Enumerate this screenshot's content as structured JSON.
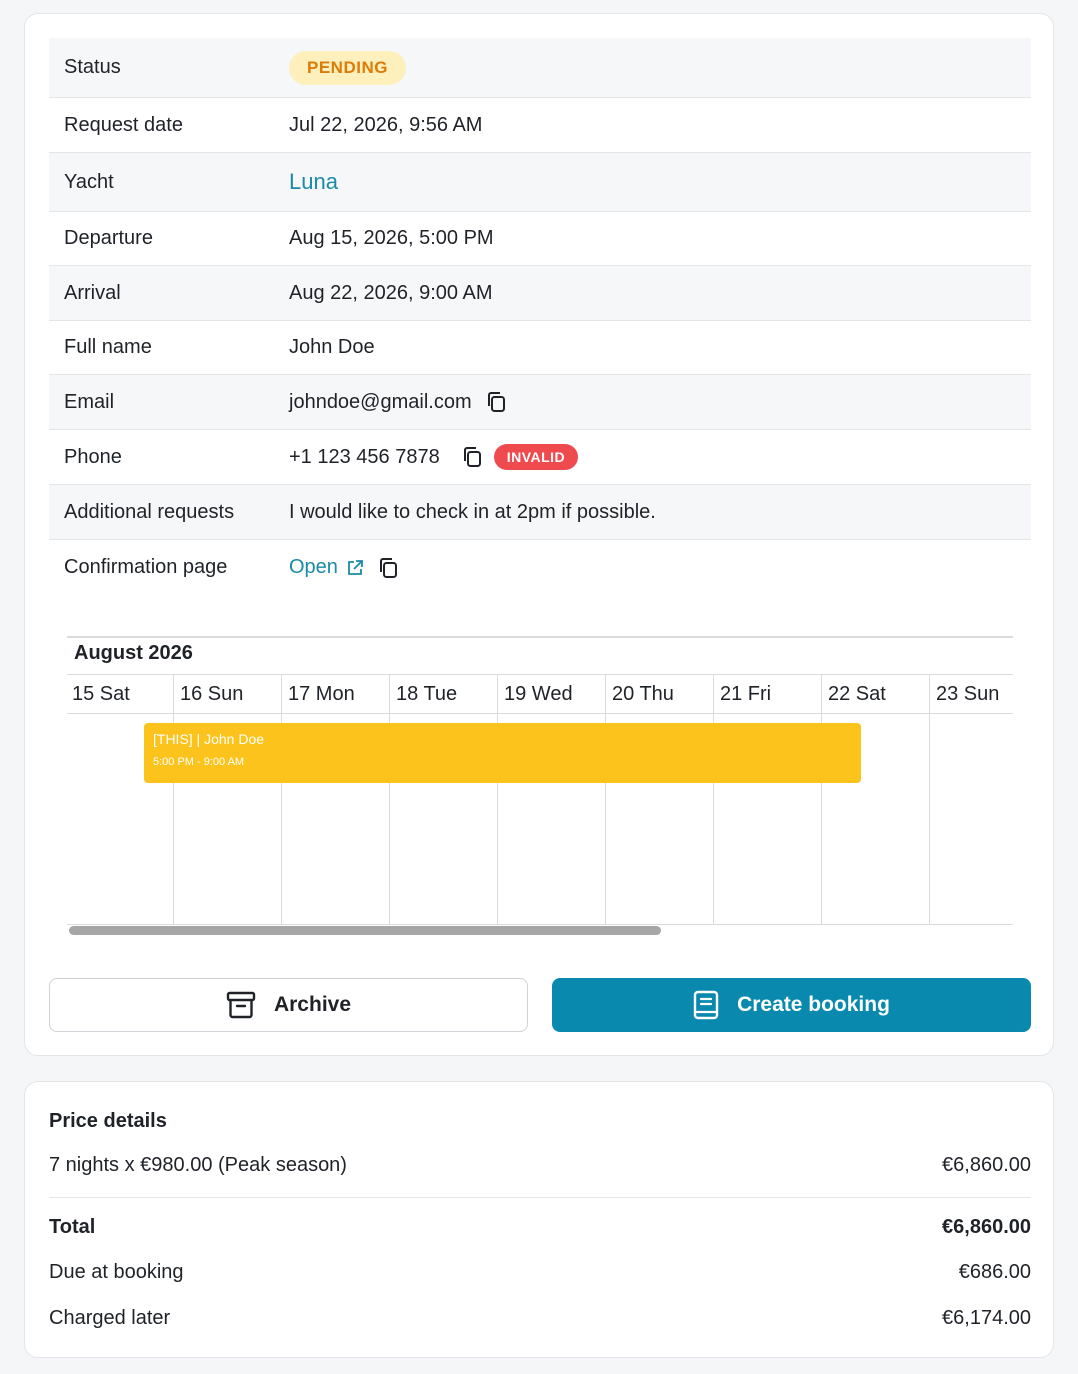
{
  "details": {
    "status": {
      "label": "Status",
      "value": "PENDING"
    },
    "request_date": {
      "label": "Request date",
      "value": "Jul 22, 2026, 9:56 AM"
    },
    "yacht": {
      "label": "Yacht",
      "value": "Luna"
    },
    "departure": {
      "label": "Departure",
      "value": "Aug 15, 2026, 5:00 PM"
    },
    "arrival": {
      "label": "Arrival",
      "value": "Aug 22, 2026, 9:00 AM"
    },
    "full_name": {
      "label": "Full name",
      "value": "John Doe"
    },
    "email": {
      "label": "Email",
      "value": "johndoe@gmail.com"
    },
    "phone": {
      "label": "Phone",
      "value": "+1 123 456 7878",
      "badge": "INVALID"
    },
    "additional_requests": {
      "label": "Additional requests",
      "value": "I would like to check in at 2pm if possible."
    },
    "confirmation_page": {
      "label": "Confirmation page",
      "value": "Open"
    }
  },
  "calendar": {
    "month": "August 2026",
    "days": [
      "15 Sat",
      "16 Sun",
      "17 Mon",
      "18 Tue",
      "19 Wed",
      "20 Thu",
      "21 Fri",
      "22 Sat",
      "23 Sun"
    ],
    "event": {
      "title": "[THIS] | John Doe",
      "time": "5:00 PM - 9:00 AM",
      "color": "#fbc31c"
    }
  },
  "actions": {
    "archive_label": "Archive",
    "create_label": "Create booking"
  },
  "price": {
    "title": "Price details",
    "line_item": {
      "label": "7 nights x €980.00 (Peak season)",
      "amount": "€6,860.00"
    },
    "total": {
      "label": "Total",
      "amount": "€6,860.00"
    },
    "due": {
      "label": "Due at booking",
      "amount": "€686.00"
    },
    "later": {
      "label": "Charged later",
      "amount": "€6,174.00"
    }
  },
  "colors": {
    "accent": "#0889ad",
    "link": "#1a8aa6",
    "pending_bg": "#fdf0bd",
    "pending_text": "#dc7b06",
    "invalid_bg": "#ef4b4f"
  }
}
